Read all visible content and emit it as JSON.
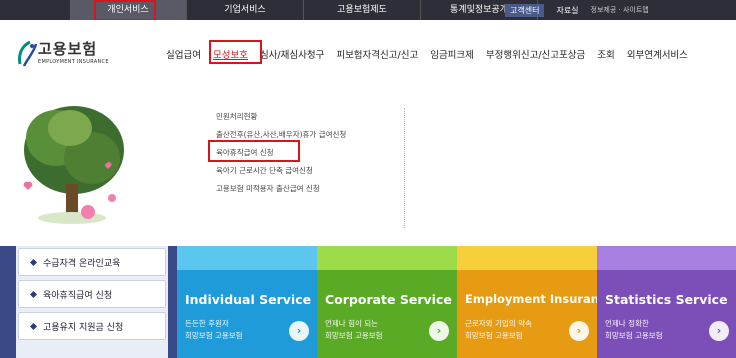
{
  "topbar": {
    "tabs": [
      "개인서비스",
      "기업서비스",
      "고용보험제도",
      "통계및정보공개"
    ],
    "active_tab": "개인서비스",
    "util": {
      "customer_center": "고객센터",
      "library": "자료실",
      "links": "정보제공 · 사이트맵"
    }
  },
  "logo": {
    "title": "고용보험",
    "subtitle": "EMPLOYMENT INSURANCE"
  },
  "gnb": {
    "items": [
      "실업급여",
      "모성보호",
      "심사/재심사청구",
      "피보험자격신고/신고",
      "임금피크제",
      "부정행위신고/신고포상금",
      "조회",
      "외부연계서비스"
    ],
    "active": "모성보호"
  },
  "submenu": {
    "items": [
      "민원처리현황",
      "출산전후(유산,사산,배우자)휴가 급여신청",
      "육아휴직급여 신청",
      "육아기 근로시간 단축 급여신청",
      "고용보험 미적용자 출산급여 신청"
    ],
    "highlighted": "육아휴직급여 신청"
  },
  "quick_links": [
    "수급자격 온라인교육",
    "육아휴직급여 신청",
    "고용유지 지원금 신청"
  ],
  "services": [
    {
      "name": "Individual Service",
      "desc1": "든든한 후원자",
      "desc2": "희망보험 고용보험",
      "color": "#1e9bd8",
      "top_color": "#5cc7ee"
    },
    {
      "name": "Corporate Service",
      "desc1": "언제나 힘이 되는",
      "desc2": "희망보험 고용보험",
      "color": "#5aaa26",
      "top_color": "#9cdb49"
    },
    {
      "name": "Employment Insurance",
      "desc1": "근로자와 기업의 약속",
      "desc2": "희망보험 고용보험",
      "color": "#e79b12",
      "top_color": "#f6cf3a"
    },
    {
      "name": "Statistics Service",
      "desc1": "언제나 정확한",
      "desc2": "희망보험 고용보험",
      "color": "#7c4eb8",
      "top_color": "#a87ee0"
    }
  ]
}
